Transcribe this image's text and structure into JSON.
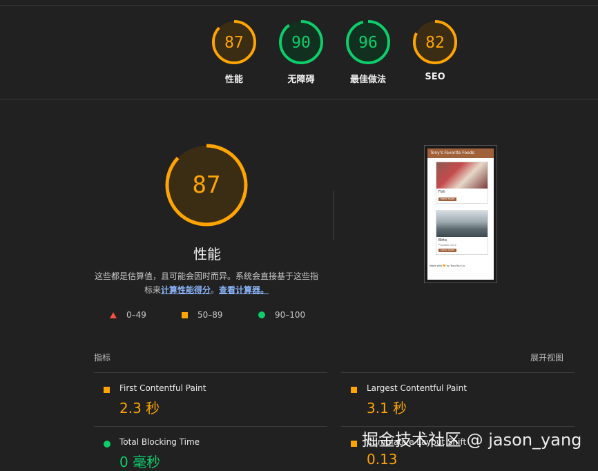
{
  "colors": {
    "background": "#212121",
    "average": "#ffa400",
    "pass": "#0cce6b",
    "fail": "#ff4e42",
    "link": "#8ab4f8"
  },
  "categories": [
    {
      "label": "性能",
      "score": 87,
      "status": "average"
    },
    {
      "label": "无障碍",
      "score": 90,
      "status": "pass"
    },
    {
      "label": "最佳做法",
      "score": 96,
      "status": "pass"
    },
    {
      "label": "SEO",
      "score": 82,
      "status": "average"
    }
  ],
  "main": {
    "score": "87",
    "score_value": 87,
    "title": "性能",
    "description_prefix": "这些都是估算值，且可能会因时而异。系统会直接基于这些指标来",
    "link_calc": "计算性能得分",
    "sep": "。",
    "link_calculator": "查看计算器。"
  },
  "legend": [
    {
      "icon": "triangle-icon",
      "range": "0–49"
    },
    {
      "icon": "square-icon",
      "range": "50–89"
    },
    {
      "icon": "circle-icon",
      "range": "90–100"
    }
  ],
  "thumbnail": {
    "header": "Tony's Favorite Foods",
    "item1": {
      "name": "Fish",
      "sub": "",
      "button": "PRESS HOME"
    },
    "item2": {
      "name": "Birto",
      "sub": "Probable clone",
      "button": "PRESS HOME"
    },
    "footer": "Made with 🧡 by Tony Bar Co."
  },
  "metrics_section": {
    "title": "指标",
    "expand": "展开视图"
  },
  "metrics": [
    {
      "name": "First Contentful Paint",
      "value": "2.3 秒",
      "status": "average"
    },
    {
      "name": "Largest Contentful Paint",
      "value": "3.1 秒",
      "status": "average"
    },
    {
      "name": "Total Blocking Time",
      "value": "0 毫秒",
      "status": "pass"
    },
    {
      "name": "Cumulative Layout Shift",
      "value": "0.13",
      "status": "average"
    }
  ],
  "watermark": "掘金技术社区 @ jason_yang"
}
